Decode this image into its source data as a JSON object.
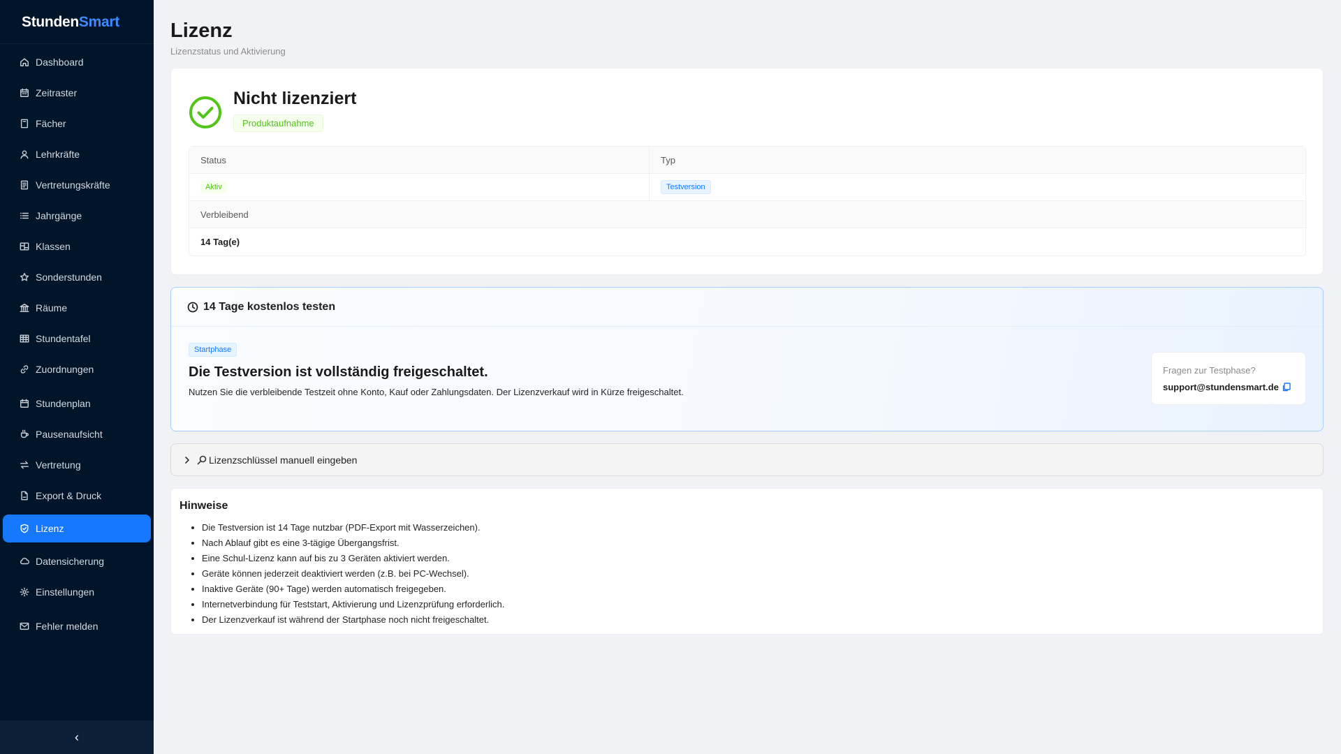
{
  "app": {
    "logo_part1": "Stunden",
    "logo_part2": "Smart",
    "accent_color": "#1677ff",
    "sidebar_bg": "#001529"
  },
  "sidebar": {
    "items": [
      {
        "label": "Dashboard",
        "icon": "home-icon"
      },
      {
        "label": "Zeitraster",
        "icon": "calendar-icon"
      },
      {
        "label": "Fächer",
        "icon": "book-icon"
      },
      {
        "label": "Lehrkräfte",
        "icon": "user-icon"
      },
      {
        "label": "Vertretungskräfte",
        "icon": "file-user-icon"
      },
      {
        "label": "Jahrgänge",
        "icon": "list-icon"
      },
      {
        "label": "Klassen",
        "icon": "table-icon"
      },
      {
        "label": "Sonderstunden",
        "icon": "star-icon"
      },
      {
        "label": "Räume",
        "icon": "bank-icon"
      },
      {
        "label": "Stundentafel",
        "icon": "grid-icon"
      },
      {
        "label": "Zuordnungen",
        "icon": "link-icon"
      },
      {
        "label": "Stundenplan",
        "icon": "schedule-icon"
      },
      {
        "label": "Pausenaufsicht",
        "icon": "coffee-icon"
      },
      {
        "label": "Vertretung",
        "icon": "swap-icon"
      },
      {
        "label": "Export & Druck",
        "icon": "file-export-icon"
      },
      {
        "label": "Lizenz",
        "icon": "shield-icon",
        "active": true
      },
      {
        "label": "Datensicherung",
        "icon": "cloud-sync-icon"
      },
      {
        "label": "Einstellungen",
        "icon": "gear-icon"
      },
      {
        "label": "Fehler melden",
        "icon": "mail-icon"
      }
    ],
    "collapse_glyph": "‹"
  },
  "page": {
    "title": "Lizenz",
    "subtitle": "Lizenzstatus und Aktivierung"
  },
  "license": {
    "status_title": "Nicht lizenziert",
    "tag": "Produktaufnahme",
    "table": {
      "status_header": "Status",
      "type_header": "Typ",
      "status_value": "Aktiv",
      "type_value": "Testversion",
      "remaining_header": "Verbleibend",
      "remaining_value": "14 Tag(e)"
    }
  },
  "trial": {
    "header": "14 Tage kostenlos testen",
    "tag": "Startphase",
    "title": "Die Testversion ist vollständig freigeschaltet.",
    "text": "Nutzen Sie die verbleibende Testzeit ohne Konto, Kauf oder Zahlungsdaten. Der Lizenzverkauf wird in Kürze freigeschaltet.",
    "support_question": "Fragen zur Testphase?",
    "support_email": "support@stundensmart.de"
  },
  "manual_key": {
    "label": "Lizenzschlüssel manuell eingeben"
  },
  "hints": {
    "title": "Hinweise",
    "items": [
      "Die Testversion ist 14 Tage nutzbar (PDF-Export mit Wasserzeichen).",
      "Nach Ablauf gibt es eine 3-tägige Übergangsfrist.",
      "Eine Schul-Lizenz kann auf bis zu 3 Geräten aktiviert werden.",
      "Geräte können jederzeit deaktiviert werden (z.B. bei PC-Wechsel).",
      "Inaktive Geräte (90+ Tage) werden automatisch freigegeben.",
      "Internetverbindung für Teststart, Aktivierung und Lizenzprüfung erforderlich.",
      "Der Lizenzverkauf ist während der Startphase noch nicht freigeschaltet."
    ]
  }
}
